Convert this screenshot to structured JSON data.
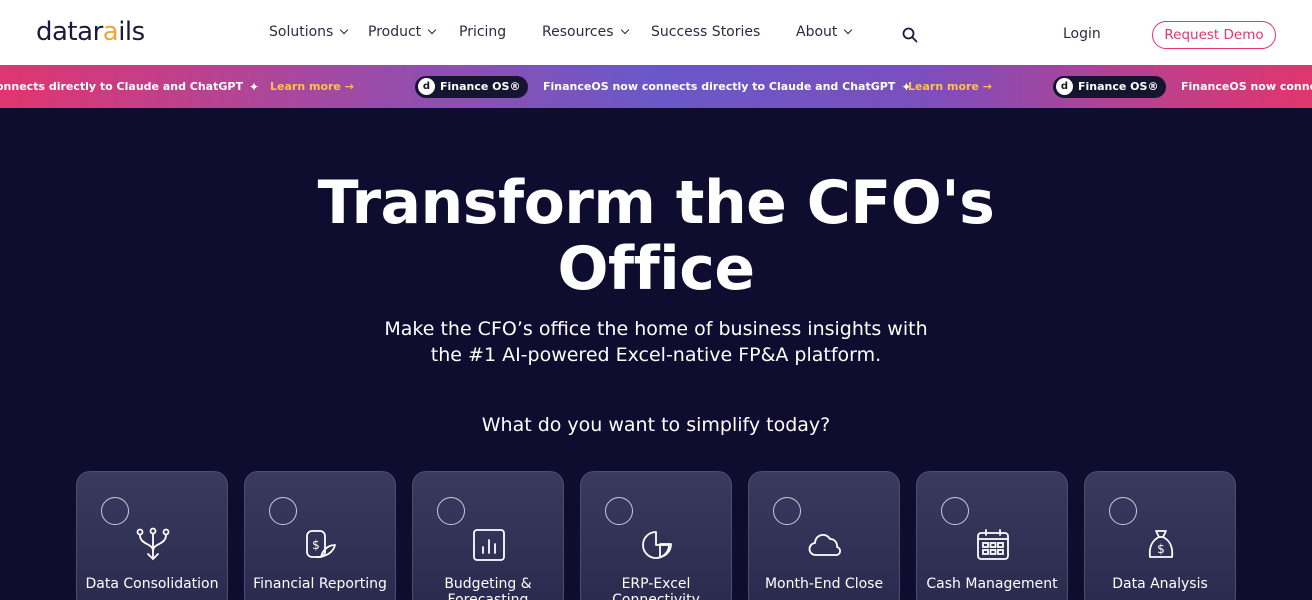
{
  "header": {
    "logo": {
      "pre": "datar",
      "dot": "a",
      "post": "ils"
    },
    "nav": [
      {
        "label": "Solutions",
        "has_dropdown": true
      },
      {
        "label": "Product",
        "has_dropdown": true
      },
      {
        "label": "Pricing",
        "has_dropdown": false
      },
      {
        "label": "Resources",
        "has_dropdown": true
      },
      {
        "label": "Success Stories",
        "has_dropdown": false
      },
      {
        "label": "About",
        "has_dropdown": true
      }
    ],
    "search_icon": "search-icon",
    "login": "Login",
    "cta": "Request Demo"
  },
  "banner": {
    "message": "FinanceOS now connects directly to Claude and ChatGPT",
    "partial_message": "onnects directly to Claude and ChatGPT",
    "partial_message_end": "FinanceOS now conne",
    "link": "Learn more →",
    "pill": "Finance OS®",
    "pill_logo": "d"
  },
  "hero": {
    "title_line1": "Transform the CFO's",
    "title_line2": "Office",
    "subtitle_line1": "Make the CFO’s office the home of business insights with",
    "subtitle_line2": "the #1 AI-powered Excel-native FP&A platform.",
    "question": "What do you want to simplify today?"
  },
  "cards": [
    {
      "label": "Data Consolidation",
      "icon": "merge-arrows-icon"
    },
    {
      "label": "Financial Reporting",
      "icon": "financial-report-icon"
    },
    {
      "label": "Budgeting & Forecasting",
      "icon": "bar-chart-icon"
    },
    {
      "label": "ERP-Excel Connectivity",
      "icon": "pie-chart-icon"
    },
    {
      "label": "Month-End Close",
      "icon": "cloud-icon"
    },
    {
      "label": "Cash Management",
      "icon": "calendar-icon"
    },
    {
      "label": "Data Analysis",
      "icon": "money-bag-icon"
    }
  ],
  "colors": {
    "hero_bg": "#0e0c2f",
    "accent_pink": "#e8336f",
    "link_yellow": "#ffc24a",
    "logo_orange": "#f2a33a"
  }
}
